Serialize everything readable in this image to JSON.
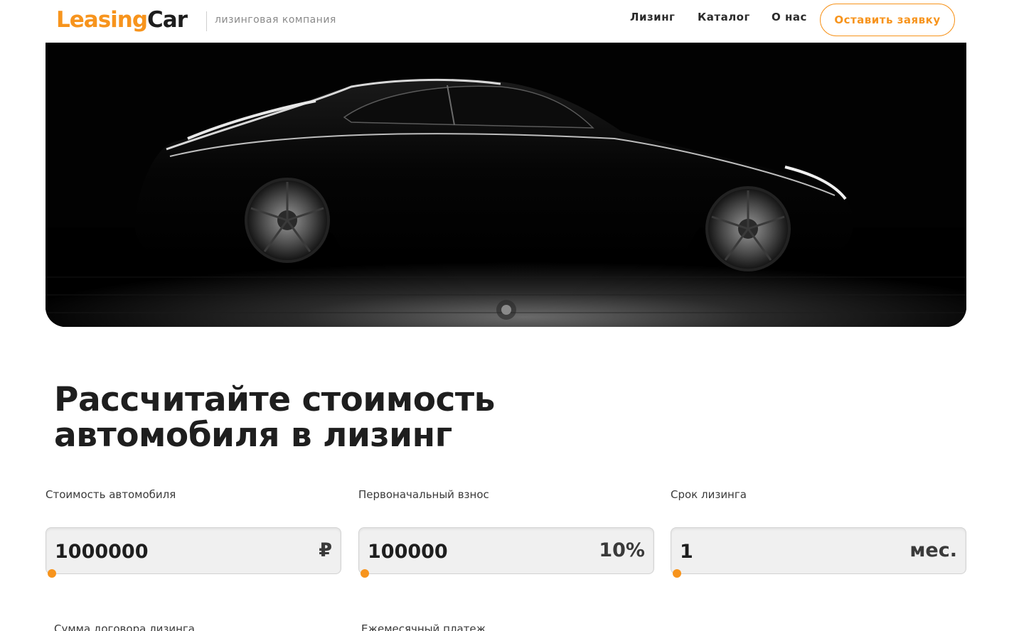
{
  "header": {
    "logo_part1": "Leasing",
    "logo_part2": "Car",
    "tagline": "лизинговая компания",
    "nav": [
      "Лизинг",
      "Каталог",
      "О нас"
    ],
    "cta_label": "Оставить заявку"
  },
  "calculator": {
    "title_line1": "Рассчитайте стоимость",
    "title_line2": "автомобиля в лизинг",
    "fields": [
      {
        "label": "Стоимость автомобиля",
        "value": "1000000",
        "suffix": "₽"
      },
      {
        "label": "Первоначальный взнос",
        "value": "100000",
        "suffix": "10%"
      },
      {
        "label": "Срок лизинга",
        "value": "1",
        "suffix": "мес."
      }
    ],
    "results": [
      {
        "label": "Сумма договора лизинга"
      },
      {
        "label": "Ежемесячный платеж"
      }
    ]
  },
  "colors": {
    "accent": "#f7941d",
    "text": "#1e1e1e"
  }
}
